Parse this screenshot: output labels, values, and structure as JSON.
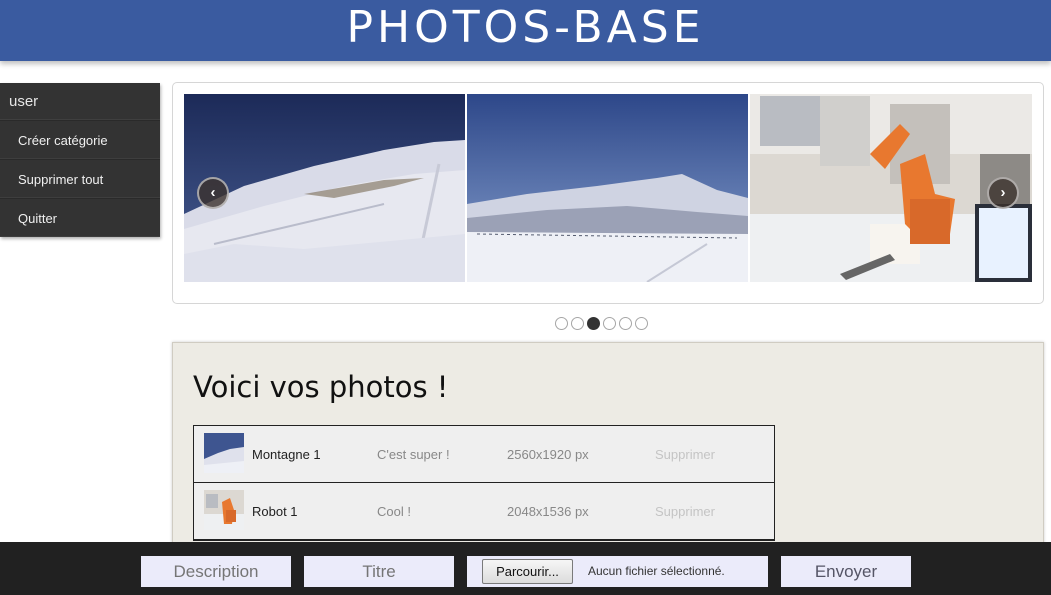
{
  "header": {
    "title": "PHOTOS-BASE"
  },
  "sidebar": {
    "user": "user",
    "items": [
      {
        "label": "Créer catégorie"
      },
      {
        "label": "Supprimer tout"
      },
      {
        "label": "Quitter"
      }
    ]
  },
  "carousel": {
    "prev_symbol": "‹",
    "next_symbol": "›",
    "dot_count": 6,
    "active_dot": 3
  },
  "main": {
    "heading": "Voici vos photos !",
    "photos": [
      {
        "title": "Montagne 1",
        "description": "C'est super !",
        "size": "2560x1920 px",
        "delete_label": "Supprimer"
      },
      {
        "title": "Robot 1",
        "description": "Cool !",
        "size": "2048x1536 px",
        "delete_label": "Supprimer"
      }
    ]
  },
  "upload": {
    "description_placeholder": "Description",
    "title_placeholder": "Titre",
    "browse_label": "Parcourir...",
    "no_file_label": "Aucun fichier sélectionné.",
    "submit_label": "Envoyer"
  },
  "colors": {
    "header_bg": "#3a5ba0",
    "sidebar_bg": "#333333",
    "panel_bg": "#edebe4",
    "bottom_bar_bg": "#212121",
    "input_bg": "#ebebfa"
  }
}
